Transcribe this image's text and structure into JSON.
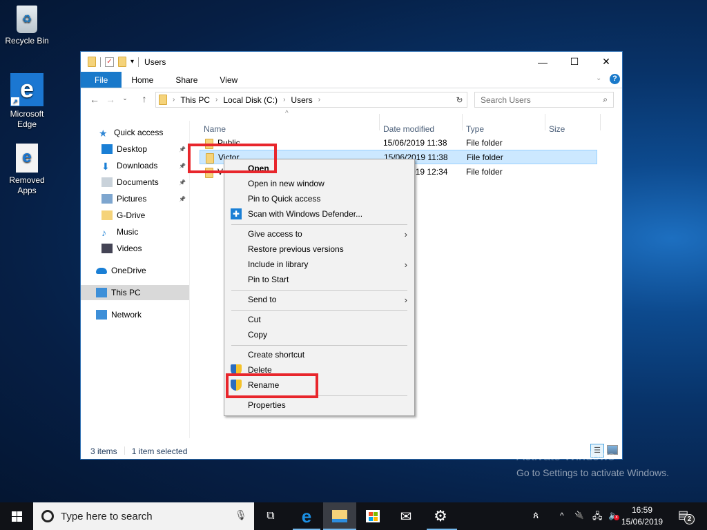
{
  "desktop": {
    "icons": [
      {
        "label": "Recycle Bin",
        "icon": "recycle-bin-icon"
      },
      {
        "label": "Microsoft Edge",
        "icon": "edge-icon"
      },
      {
        "label": "Removed Apps",
        "icon": "edge-document-icon"
      }
    ],
    "watermark": {
      "title": "Activate Windows",
      "subtitle": "Go to Settings to activate Windows."
    }
  },
  "window": {
    "title": "Users",
    "controls": {
      "minimize": "—",
      "maximize": "☐",
      "close": "✕"
    },
    "ribbon": {
      "tabs": [
        "File",
        "Home",
        "Share",
        "View"
      ],
      "help": "?"
    },
    "nav": {
      "breadcrumb": [
        "This PC",
        "Local Disk (C:)",
        "Users"
      ],
      "search_placeholder": "Search Users"
    },
    "sidebar": {
      "items": [
        {
          "label": "Quick access",
          "icon": "star-icon",
          "pinned": false
        },
        {
          "label": "Desktop",
          "icon": "desktop-icon",
          "pinned": true
        },
        {
          "label": "Downloads",
          "icon": "download-icon",
          "pinned": true
        },
        {
          "label": "Documents",
          "icon": "documents-icon",
          "pinned": true
        },
        {
          "label": "Pictures",
          "icon": "pictures-icon",
          "pinned": true
        },
        {
          "label": "G-Drive",
          "icon": "folder-drive-icon",
          "pinned": false
        },
        {
          "label": "Music",
          "icon": "music-icon",
          "pinned": false
        },
        {
          "label": "Videos",
          "icon": "videos-icon",
          "pinned": false
        },
        {
          "label": "OneDrive",
          "icon": "onedrive-icon",
          "pinned": false
        },
        {
          "label": "This PC",
          "icon": "this-pc-icon",
          "pinned": false,
          "selected": true
        },
        {
          "label": "Network",
          "icon": "network-icon",
          "pinned": false
        }
      ]
    },
    "columns": [
      "Name",
      "Date modified",
      "Type",
      "Size"
    ],
    "files": [
      {
        "name": "Public",
        "date": "15/06/2019 11:38",
        "type": "File folder",
        "size": ""
      },
      {
        "name": "Victor",
        "date": "15/06/2019 11:38",
        "type": "File folder",
        "size": "",
        "selected": true
      },
      {
        "name": "V",
        "date": "15/06/2019 12:34",
        "type": "File folder",
        "size": ""
      }
    ],
    "status": {
      "count": "3 items",
      "selection": "1 item selected"
    }
  },
  "context_menu": {
    "items": [
      {
        "label": "Open",
        "bold": true
      },
      {
        "label": "Open in new window"
      },
      {
        "label": "Pin to Quick access"
      },
      {
        "label": "Scan with Windows Defender...",
        "icon": "defender-icon"
      },
      {
        "separator": true
      },
      {
        "label": "Give access to",
        "submenu": true
      },
      {
        "label": "Restore previous versions"
      },
      {
        "label": "Include in library",
        "submenu": true
      },
      {
        "label": "Pin to Start"
      },
      {
        "separator": true
      },
      {
        "label": "Send to",
        "submenu": true
      },
      {
        "separator": true
      },
      {
        "label": "Cut"
      },
      {
        "label": "Copy"
      },
      {
        "separator": true
      },
      {
        "label": "Create shortcut"
      },
      {
        "label": "Delete",
        "icon": "uac-shield-icon"
      },
      {
        "label": "Rename",
        "icon": "uac-shield-icon",
        "highlighted": true
      },
      {
        "separator": true
      },
      {
        "label": "Properties"
      }
    ],
    "highlight_color": "#e8262c"
  },
  "taskbar": {
    "search_placeholder": "Type here to search",
    "apps": [
      "task-view-icon",
      "edge-icon",
      "file-explorer-icon",
      "store-icon",
      "mail-icon",
      "settings-icon"
    ],
    "active_app": "file-explorer-icon",
    "clock": {
      "time": "16:59",
      "date": "15/06/2019"
    },
    "notifications_count": "2"
  },
  "colors": {
    "accent": "#1979ca",
    "selection": "#cce8ff",
    "annotation": "#e8262c"
  }
}
